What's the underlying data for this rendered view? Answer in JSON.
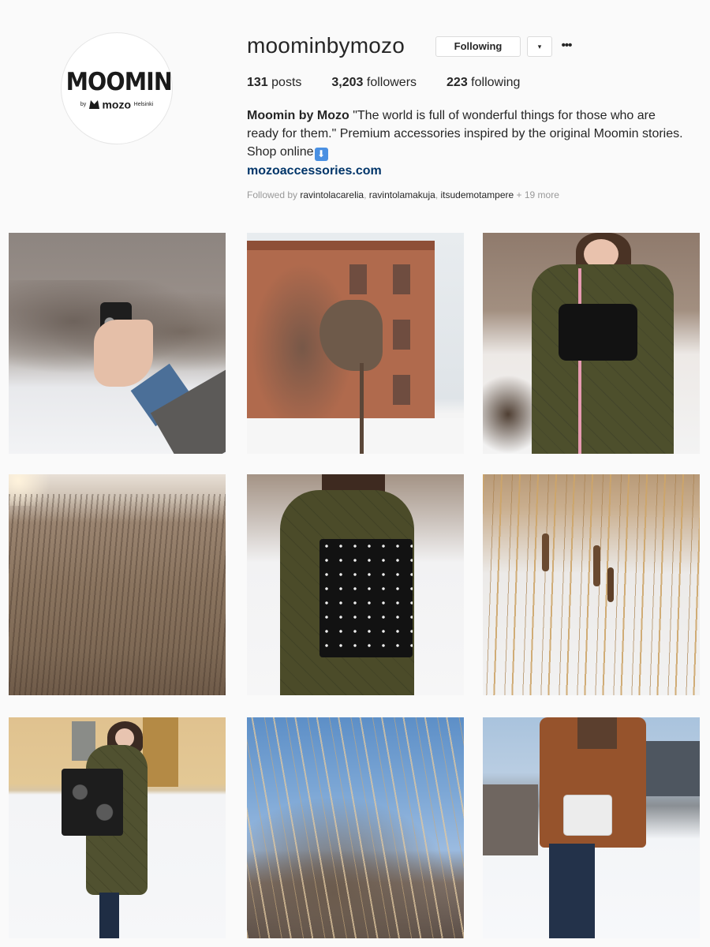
{
  "profile": {
    "username": "moominbymozo",
    "following_label": "Following",
    "dropdown_icon": "▾",
    "more_icon": "•••",
    "avatar": {
      "word": "MOOMIN",
      "by": "by",
      "brand": "mozo",
      "city": "Helsinki"
    },
    "stats": [
      {
        "value": "131",
        "label": " posts"
      },
      {
        "value": "3,203",
        "label": " followers"
      },
      {
        "value": "223",
        "label": " following"
      }
    ],
    "bio": {
      "name": "Moomin by Mozo",
      "text": " \"The world is full of wonderful things for those who are ready for them.\" Premium accessories inspired by the original Moomin stories. Shop online",
      "emoji": "⬇",
      "link": "mozoaccessories.com"
    },
    "followed_by": {
      "prefix": "Followed by ",
      "users": [
        "ravintolacarelia",
        "ravintolamakuja",
        "itsudemotampere"
      ],
      "sep": ", ",
      "more": " + 19 more"
    }
  },
  "colors": {
    "background": "#fafafa",
    "link": "#003569",
    "muted": "#999999",
    "border": "#dbdbdb"
  },
  "posts": [
    {
      "name": "post-phone-case-hand"
    },
    {
      "name": "post-horse-sculpture-building"
    },
    {
      "name": "post-woman-green-coat-pouch"
    },
    {
      "name": "post-reeds-field-sunset"
    },
    {
      "name": "post-tote-bag-green-coat"
    },
    {
      "name": "post-cattails-snow"
    },
    {
      "name": "post-woman-tote-snow-street"
    },
    {
      "name": "post-dry-grass-blue-sky"
    },
    {
      "name": "post-brown-coat-shoulder-bag"
    }
  ]
}
